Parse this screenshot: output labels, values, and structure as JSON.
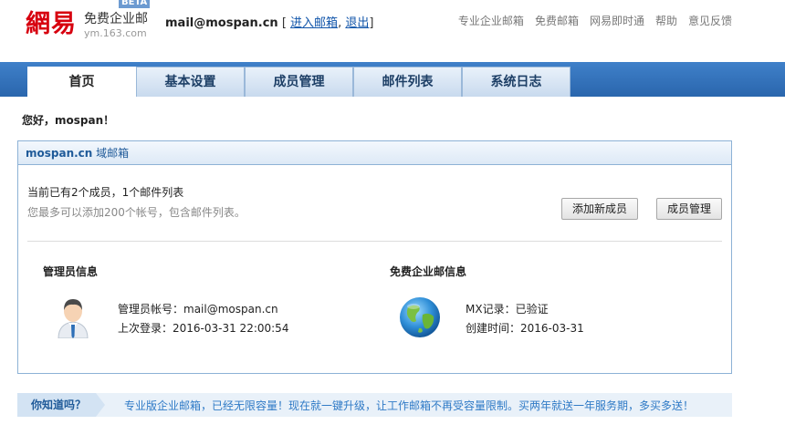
{
  "brand": {
    "logo_text": "網易",
    "title": "免费企业邮",
    "beta": "BETA",
    "domain": "ym.163.com"
  },
  "account": {
    "address": "mail@mospan.cn",
    "open_bracket": "[",
    "enter_mail": "进入邮箱",
    "separator": ",",
    "logout": "退出",
    "close_bracket": "]"
  },
  "top_nav": [
    "专业企业邮箱",
    "免费邮箱",
    "网易即时通",
    "帮助",
    "意见反馈"
  ],
  "tabs": [
    {
      "label": "首页",
      "active": true
    },
    {
      "label": "基本设置",
      "active": false
    },
    {
      "label": "成员管理",
      "active": false
    },
    {
      "label": "邮件列表",
      "active": false
    },
    {
      "label": "系统日志",
      "active": false
    }
  ],
  "greeting": "您好，mospan！",
  "panel": {
    "domain": "mospan.cn",
    "suffix": " 域邮箱",
    "stats_line": "当前已有2个成员，1个邮件列表",
    "hint_line": "您最多可以添加200个帐号，包含邮件列表。",
    "add_member_button": "添加新成员",
    "member_manage_button": "成员管理",
    "admin": {
      "title": "管理员信息",
      "account_line": "管理员帐号：mail@mospan.cn",
      "last_login_line": "上次登录：2016-03-31 22:00:54"
    },
    "free": {
      "title": "免费企业邮信息",
      "mx_line": "MX记录：已验证",
      "created_line": "创建时间：2016-03-31"
    }
  },
  "tip": {
    "label": "你知道吗？",
    "text": "专业版企业邮箱，已经无限容量！现在就一键升级，让工作邮箱不再受容量限制。买两年就送一年服务期，多买多送！"
  },
  "colors": {
    "brand_red": "#d7000f",
    "tab_bar_blue": "#2a66ad",
    "link_blue": "#1155aa",
    "tip_text_blue": "#2f7ac6"
  }
}
